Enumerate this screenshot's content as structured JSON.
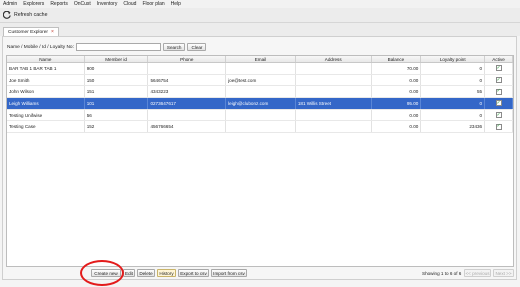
{
  "menu": [
    "Admin",
    "Explorers",
    "Reports",
    "OnCust",
    "Inventory",
    "Cloud",
    "Floor plan",
    "Help"
  ],
  "toolbar": {
    "refresh_label": "Refresh cache",
    "refresh_icon": "refresh-icon"
  },
  "tabs": [
    {
      "label": "Customer Explorer",
      "close": "×"
    }
  ],
  "search": {
    "label": "Name / Mobile / Id / Loyalty No:",
    "value": "",
    "search_label": "Search",
    "clear_label": "Clear"
  },
  "table": {
    "columns": [
      "Name",
      "Member id",
      "Phone",
      "Email",
      "Address",
      "Balance",
      "Loyalty point",
      "Active"
    ],
    "rows": [
      {
        "name": "BAR TAB 1 BAR TAB 1",
        "member_id": "900",
        "phone": "",
        "email": "",
        "address": "",
        "balance": "70.00",
        "loyalty": "0",
        "active": "✓"
      },
      {
        "name": "Joe Smith",
        "member_id": "150",
        "phone": "5646754",
        "email": "joe@test.com",
        "address": "",
        "balance": "0.00",
        "loyalty": "0",
        "active": "✓"
      },
      {
        "name": "John Wilson",
        "member_id": "151",
        "phone": "4343223",
        "email": "",
        "address": "",
        "balance": "0.00",
        "loyalty": "55",
        "active": "✓"
      },
      {
        "name": "Leigh Williams",
        "member_id": "101",
        "phone": "0273647617",
        "email": "leigh@clubonz.com",
        "address": "181 Willis Street",
        "balance": "95.00",
        "loyalty": "0",
        "active": "✓"
      },
      {
        "name": "Testing Unifwise",
        "member_id": "56",
        "phone": "",
        "email": "",
        "address": "",
        "balance": "0.00",
        "loyalty": "0",
        "active": "✓"
      },
      {
        "name": "Testing Case",
        "member_id": "152",
        "phone": "456766654",
        "email": "",
        "address": "",
        "balance": "0.00",
        "loyalty": "23436",
        "active": "✓"
      }
    ]
  },
  "footer": {
    "create_label": "Create new",
    "edit_label": "Edit",
    "delete_label": "Delete",
    "history_label": "History",
    "export_label": "Export to csv",
    "import_label": "Import from csv",
    "showing": "Showing 1 to 6 of 6",
    "prev_label": "<< previous",
    "next_label": "Next >>"
  },
  "colors": {
    "selection": "#3467c8",
    "highlight_circle": "#e31b1b"
  }
}
